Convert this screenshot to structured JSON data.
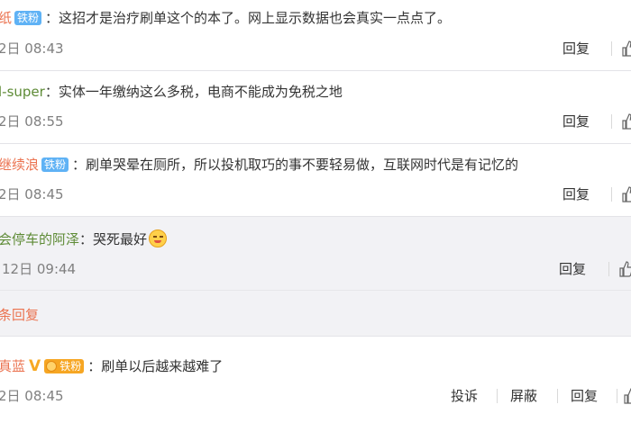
{
  "comments": [
    {
      "username": "纸",
      "badge": "铁粉",
      "separator": "：",
      "text": "这招才是治疗刷单这个的本了。网上显示数据也会真实一点点了。",
      "time": "2日 08:43",
      "reply_label": "回复"
    },
    {
      "username": "l-super",
      "separator": "：",
      "text": "实体一年缴纳这么多税，电商不能成为免税之地",
      "time": "2日 08:55",
      "reply_label": "回复"
    },
    {
      "username": "继续浪",
      "badge": "铁粉",
      "separator": "：",
      "text": "刷单哭晕在厕所，所以投机取巧的事不要轻易做，互联网时代是有记忆的",
      "time": "2日 08:45",
      "reply_label": "回复"
    }
  ],
  "reply_thread": {
    "username": "会停车的阿泽",
    "separator": "：",
    "text": "哭死最好",
    "emoji": "smile-face",
    "time": "12日 09:44",
    "reply_label": "回复",
    "more_label": "条回复"
  },
  "last_comment": {
    "username": "真蓝",
    "vip_mark": "V",
    "badge": "铁粉",
    "separator": "：",
    "text": "刷单以后越来越难了",
    "time": "2日 08:45",
    "report_label": "投诉",
    "block_label": "屏蔽",
    "reply_label": "回复"
  },
  "colors": {
    "username": "#eb7350",
    "username_green": "#5e8b36",
    "badge_blue": "#5fb2f5",
    "badge_gold": "#f6a623",
    "muted": "#808080"
  }
}
